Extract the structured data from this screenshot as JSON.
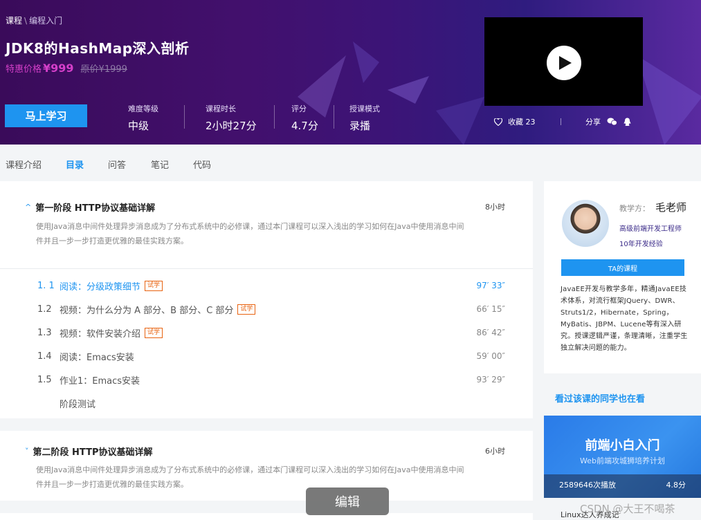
{
  "header": {
    "breadcrumb": {
      "root": "课程",
      "sep": "\\",
      "current": "编程入门"
    },
    "title": "JDK8的HashMap深入剖析",
    "price_label": "特惠价格",
    "price": "¥999",
    "original_price": "原价¥1999",
    "cta_label": "马上学习",
    "stats": [
      {
        "label": "难度等级",
        "value": "中级"
      },
      {
        "label": "课程时长",
        "value": "2小时27分"
      },
      {
        "label": "评分",
        "value": "4.7分"
      },
      {
        "label": "授课模式",
        "value": "录播"
      }
    ],
    "favorite": {
      "icon": "heart-icon",
      "label": "收藏",
      "count": "23"
    },
    "share": {
      "label": "分享",
      "icons": [
        "wechat-icon",
        "qq-icon"
      ]
    },
    "video_icon": "play-icon"
  },
  "tabs": [
    {
      "label": "课程介绍",
      "active": false
    },
    {
      "label": "目录",
      "active": true
    },
    {
      "label": "问答",
      "active": false
    },
    {
      "label": "笔记",
      "active": false
    },
    {
      "label": "代码",
      "active": false
    }
  ],
  "stages": [
    {
      "chevron": "^",
      "title": "第一阶段  HTTP协议基础详解",
      "duration": "8小时",
      "desc_line1": "使用Java消息中间件处理异步消息成为了分布式系统中的必修课，通过本门课程可以深入浅出的学习如何在Java中使用消息中间",
      "desc_line2": "件并且一步一步打造更优雅的最佳实践方案。",
      "lessons": [
        {
          "num": "1. 1",
          "title": "阅读：分级政策细节",
          "tag": "试学",
          "time": "97′ 33″",
          "current": true
        },
        {
          "num": "1.2",
          "title": "视频：为什么分为 A 部分、B 部分、C 部分",
          "tag": "试学",
          "time": "66′ 15″",
          "current": false
        },
        {
          "num": "1.3",
          "title": "视频：软件安装介绍",
          "tag": "试学",
          "time": "86′ 42″",
          "current": false
        },
        {
          "num": "1.4",
          "title": "阅读：Emacs安装",
          "tag": "",
          "time": "59′ 00″",
          "current": false
        },
        {
          "num": "1.5",
          "title": "作业1：Emacs安装",
          "tag": "",
          "time": "93′ 29″",
          "current": false
        }
      ],
      "test_label": "阶段测试"
    },
    {
      "chevron": "˅",
      "title": "第二阶段  HTTP协议基础详解",
      "duration": "6小时",
      "desc_line1": "使用Java消息中间件处理异步消息成为了分布式系统中的必修课，通过本门课程可以深入浅出的学习如何在Java中使用消息中间",
      "desc_line2": "件并且一步一步打造更优雅的最佳实践方案。"
    }
  ],
  "teacher": {
    "label": "教学方：",
    "name": "毛老师",
    "role": "高级前端开发工程师",
    "experience": "10年开发经验",
    "courses_button": "TA的课程",
    "bio": "JavaEE开发与教学多年，精通JavaEE技术体系，对流行框架JQuery、DWR、Struts1/2，Hibernate，Spring，MyBatis、JBPM、Lucene等有深入研究。授课逻辑严谨，条理清晰，注重学生独立解决问题的能力。"
  },
  "also_viewed": {
    "heading": "看过该课的同学也在看",
    "card": {
      "title": "前端小白入门",
      "subtitle": "Web前端攻城狮培养计划",
      "plays": "2589646次播放",
      "score": "4.8分"
    },
    "next_caption": "Linux达人养成记"
  },
  "overlay": {
    "edit_label": "编辑",
    "watermark": "CSDN @大王不喝茶"
  }
}
